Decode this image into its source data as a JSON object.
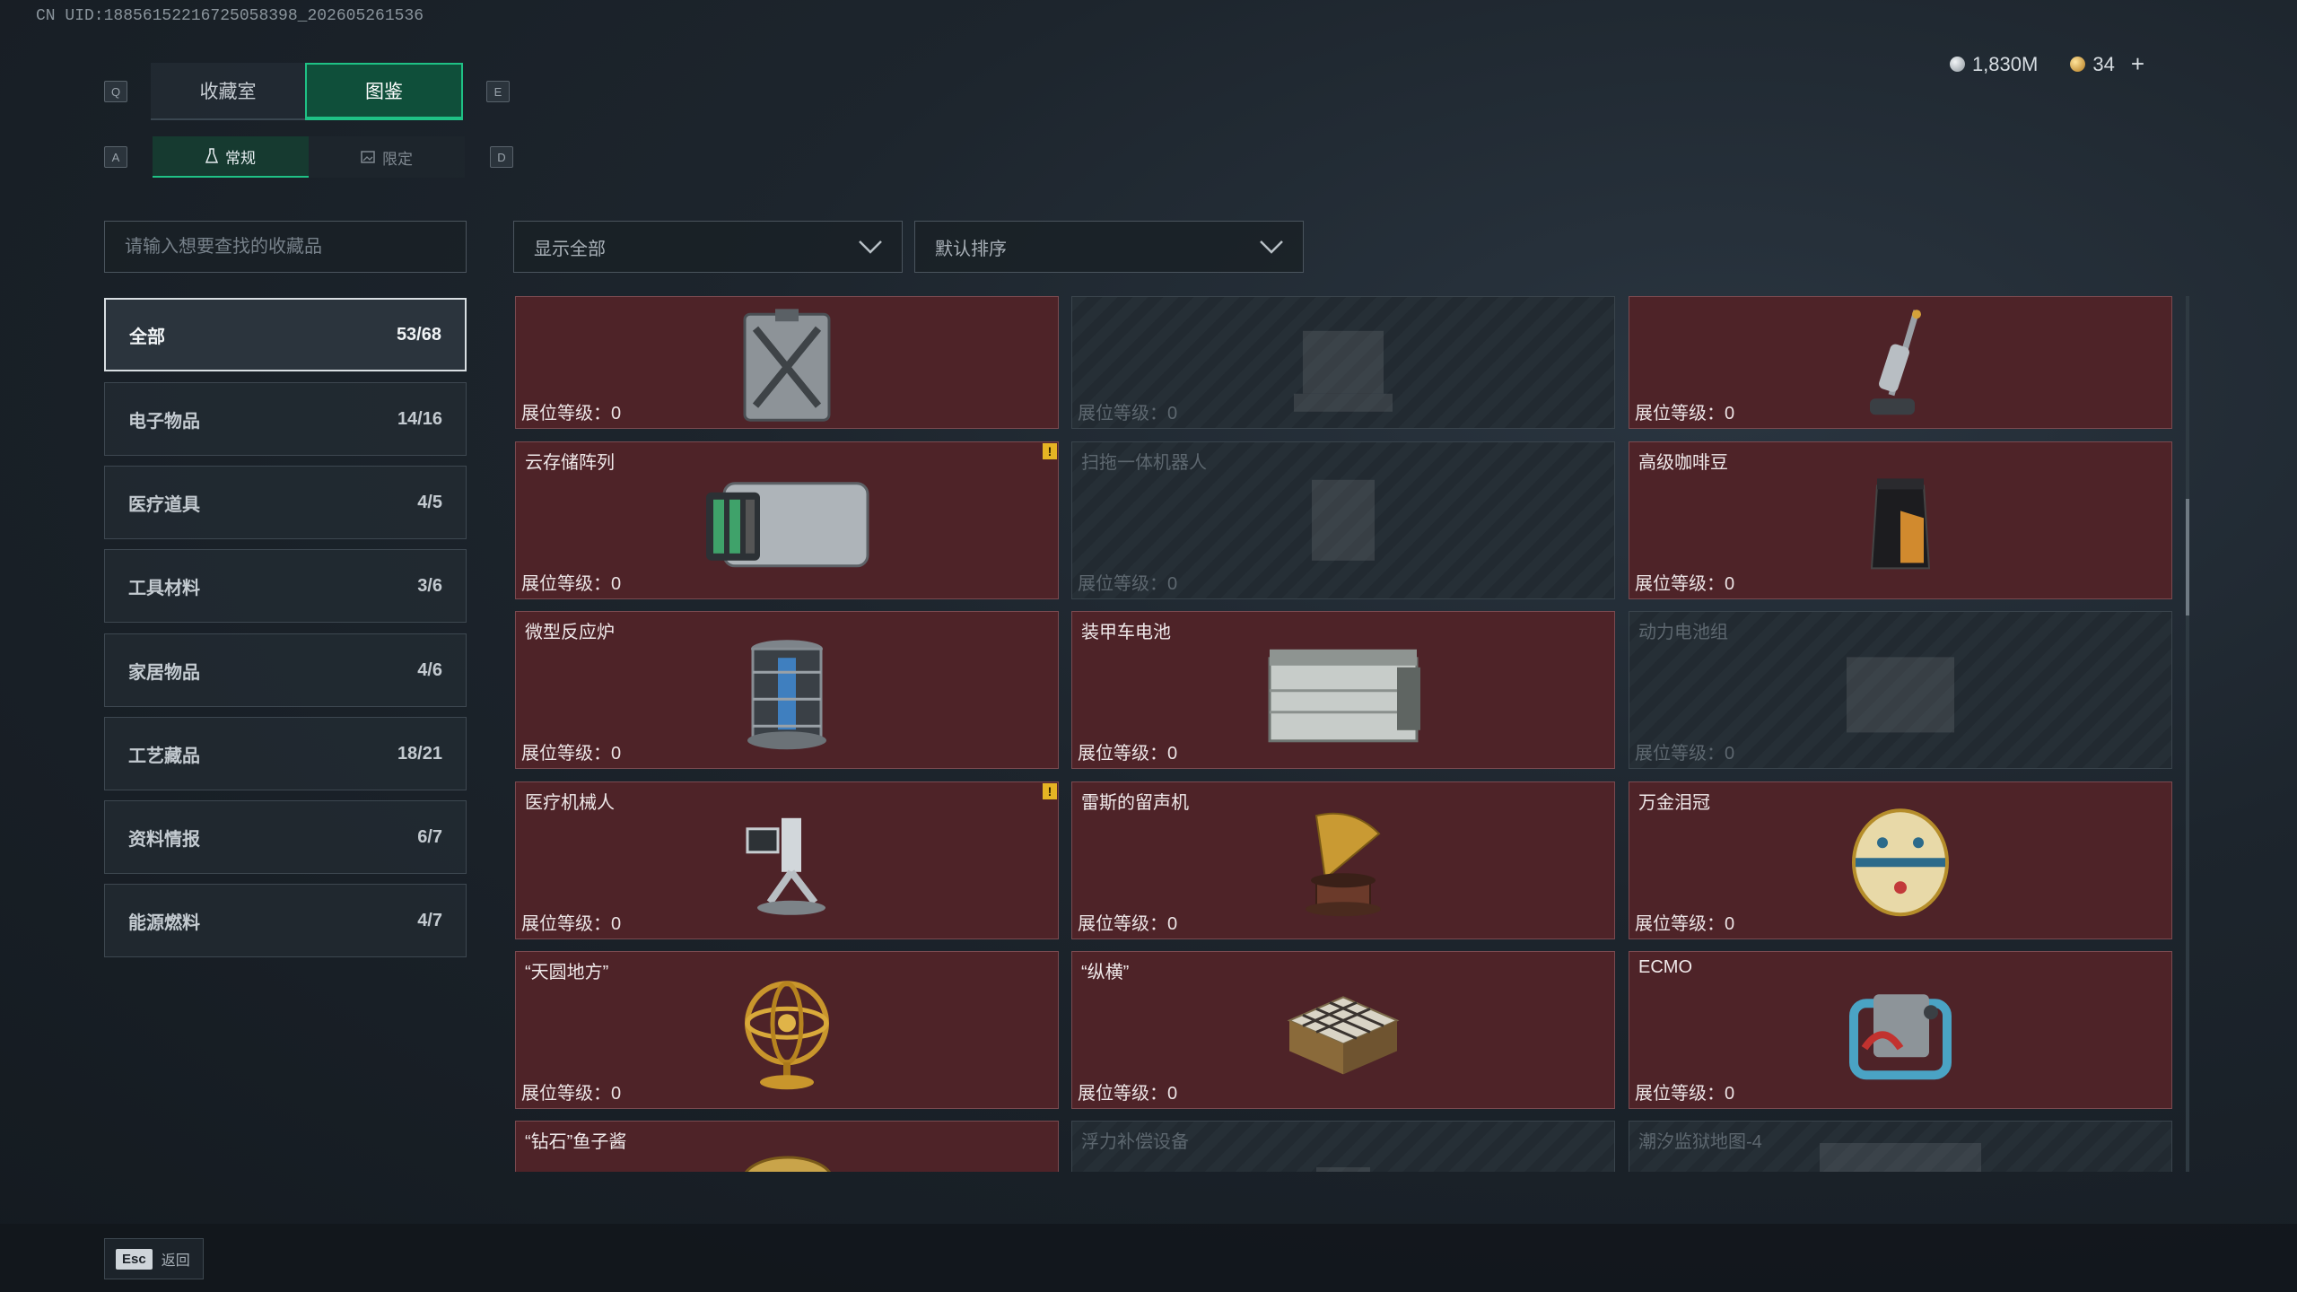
{
  "uid_text": "CN UID:18856152216725058398_202605261536",
  "keys": {
    "left_tab": "Q",
    "right_tab": "E",
    "left_sub": "A",
    "right_sub": "D"
  },
  "tabs": [
    {
      "label": "收藏室",
      "active": false
    },
    {
      "label": "图鉴",
      "active": true
    }
  ],
  "subtabs": [
    {
      "label": "常规",
      "active": true
    },
    {
      "label": "限定",
      "active": false
    }
  ],
  "currency": [
    {
      "value": "1,830M",
      "color": "#b8c0c6"
    },
    {
      "value": "34",
      "color": "#d9a441"
    }
  ],
  "currency_add": "+",
  "search": {
    "placeholder": "请输入想要查找的收藏品"
  },
  "filters": {
    "show": "显示全部",
    "sort": "默认排序"
  },
  "categories": [
    {
      "label": "全部",
      "count": "53/68",
      "active": true
    },
    {
      "label": "电子物品",
      "count": "14/16"
    },
    {
      "label": "医疗道具",
      "count": "4/5"
    },
    {
      "label": "工具材料",
      "count": "3/6"
    },
    {
      "label": "家居物品",
      "count": "4/6"
    },
    {
      "label": "工艺藏品",
      "count": "18/21"
    },
    {
      "label": "资料情报",
      "count": "6/7"
    },
    {
      "label": "能源燃料",
      "count": "4/7"
    }
  ],
  "level_label": "展位等级：0",
  "items": [
    {
      "name": "",
      "locked": false,
      "icon": "fuel-canister-icon"
    },
    {
      "name": "",
      "locked": true,
      "icon": "robot-base-icon"
    },
    {
      "name": "",
      "locked": false,
      "icon": "floor-vacuum-icon"
    },
    {
      "name": "云存储阵列",
      "locked": false,
      "icon": "cloud-storage-array-icon",
      "alert": true
    },
    {
      "name": "扫拖一体机器人",
      "locked": true,
      "icon": "mop-robot-icon"
    },
    {
      "name": "高级咖啡豆",
      "locked": false,
      "icon": "coffee-bag-icon"
    },
    {
      "name": "微型反应炉",
      "locked": false,
      "icon": "micro-reactor-icon"
    },
    {
      "name": "装甲车电池",
      "locked": false,
      "icon": "armored-battery-icon"
    },
    {
      "name": "动力电池组",
      "locked": true,
      "icon": "power-battery-pack-icon"
    },
    {
      "name": "医疗机械人",
      "locked": false,
      "icon": "medical-robot-icon",
      "alert": true
    },
    {
      "name": "雷斯的留声机",
      "locked": false,
      "icon": "gramophone-icon"
    },
    {
      "name": "万金泪冠",
      "locked": false,
      "icon": "jeweled-egg-icon"
    },
    {
      "name": "“天圆地方”",
      "locked": false,
      "icon": "armillary-sphere-icon"
    },
    {
      "name": "“纵横”",
      "locked": false,
      "icon": "chess-box-icon"
    },
    {
      "name": "ECMO",
      "locked": false,
      "icon": "ecmo-machine-icon"
    },
    {
      "name": "“钻石”鱼子酱",
      "locked": false,
      "icon": "caviar-tin-icon"
    },
    {
      "name": "浮力补偿设备",
      "locked": true,
      "icon": "bcd-icon"
    },
    {
      "name": "潮汐监狱地图-4",
      "locked": true,
      "icon": "map-icon"
    }
  ],
  "footer": {
    "esc_key": "Esc",
    "back_label": "返回"
  }
}
